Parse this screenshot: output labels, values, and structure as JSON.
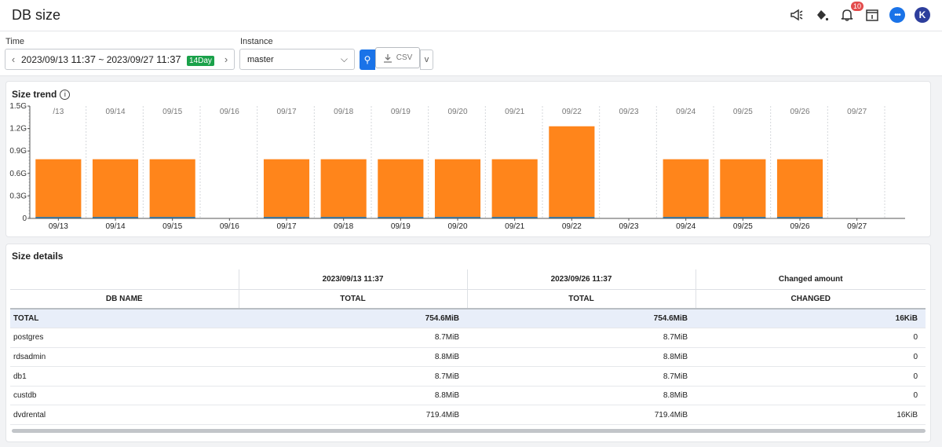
{
  "header": {
    "title": "DB size",
    "notification_count": "10",
    "avatar_initial": "K"
  },
  "filters": {
    "time_label": "Time",
    "time_start_date": "2023/09/13",
    "time_start_time": "11:37",
    "time_sep": "~",
    "time_end_date": "2023/09/27",
    "time_end_time": "11:37",
    "time_range_badge": "14Day",
    "instance_label": "Instance",
    "instance_value": "master",
    "csv_label": "CSV"
  },
  "size_trend": {
    "title": "Size trend"
  },
  "chart_data": {
    "type": "bar",
    "top_axis_labels": [
      "/13",
      "09/14",
      "09/15",
      "09/16",
      "09/17",
      "09/18",
      "09/19",
      "09/20",
      "09/21",
      "09/22",
      "09/23",
      "09/24",
      "09/25",
      "09/26",
      "09/27"
    ],
    "categories": [
      "09/13",
      "09/14",
      "09/15",
      "09/16",
      "09/17",
      "09/18",
      "09/19",
      "09/20",
      "09/21",
      "09/22",
      "09/23",
      "09/24",
      "09/25",
      "09/26",
      "09/27"
    ],
    "series": [
      {
        "color": "#1f77b4",
        "values": [
          0.02,
          0.02,
          0.02,
          null,
          0.02,
          0.02,
          0.02,
          0.02,
          0.02,
          0.02,
          null,
          0.02,
          0.02,
          0.02,
          null
        ]
      },
      {
        "color": "#ff851b",
        "values": [
          0.77,
          0.77,
          0.77,
          null,
          0.77,
          0.77,
          0.77,
          0.77,
          0.77,
          1.21,
          null,
          0.77,
          0.77,
          0.77,
          null
        ]
      }
    ],
    "y_ticks": [
      "0",
      "0.3G",
      "0.6G",
      "0.9G",
      "1.2G",
      "1.5G"
    ],
    "ylim": [
      0,
      1.5
    ],
    "stacked": true,
    "grid": "vertical-dashed"
  },
  "size_details": {
    "title": "Size details",
    "group_headers": [
      "",
      "2023/09/13 11:37",
      "2023/09/26 11:37",
      "Changed amount"
    ],
    "columns": [
      "DB NAME",
      "TOTAL",
      "TOTAL",
      "CHANGED"
    ],
    "rows": [
      {
        "name": "TOTAL",
        "start": "754.6MiB",
        "end": "754.6MiB",
        "changed": "16KiB"
      },
      {
        "name": "postgres",
        "start": "8.7MiB",
        "end": "8.7MiB",
        "changed": "0"
      },
      {
        "name": "rdsadmin",
        "start": "8.8MiB",
        "end": "8.8MiB",
        "changed": "0"
      },
      {
        "name": "db1",
        "start": "8.7MiB",
        "end": "8.7MiB",
        "changed": "0"
      },
      {
        "name": "custdb",
        "start": "8.8MiB",
        "end": "8.8MiB",
        "changed": "0"
      },
      {
        "name": "dvdrental",
        "start": "719.4MiB",
        "end": "719.4MiB",
        "changed": "16KiB"
      }
    ]
  }
}
